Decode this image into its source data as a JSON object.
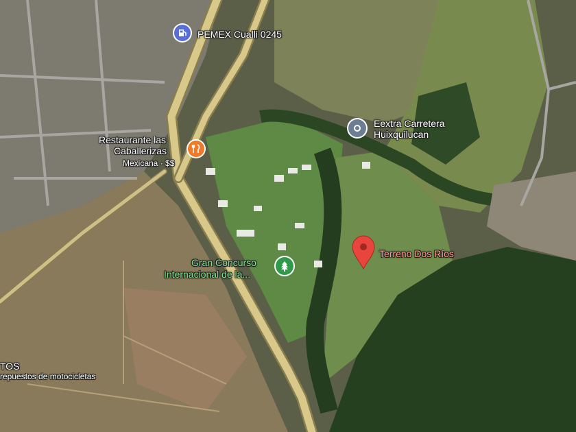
{
  "colors": {
    "road": "#d8c98a",
    "road_edge": "#8a7d4e",
    "gas_pin": "#5a6fd6",
    "food_pin": "#f07a2a",
    "poi_pin": "#6c7e93",
    "park_pin": "#2e9a4a",
    "marker": "#e8453c"
  },
  "places": {
    "pemex": {
      "icon": "gas-station-icon",
      "name": "PEMEX Cualli 0245"
    },
    "restaurant": {
      "icon": "restaurant-icon",
      "name_line1": "Restaurante las",
      "name_line2": "Caballerizas",
      "subtitle": "Mexicana · $$"
    },
    "carretera": {
      "icon": "place-pin-icon",
      "name_line1": "Eextra Carretera",
      "name_line2": "Huixquilucan"
    },
    "concurso": {
      "icon": "park-tree-icon",
      "name_line1": "Gran Concurso",
      "name_line2": "Internacional de la..."
    },
    "terreno": {
      "icon": "red-marker-icon",
      "name": "Terreno Dos Ríos"
    },
    "motos": {
      "name_line1": "TOS",
      "name_line2": "repuestos de motocicletas"
    }
  }
}
